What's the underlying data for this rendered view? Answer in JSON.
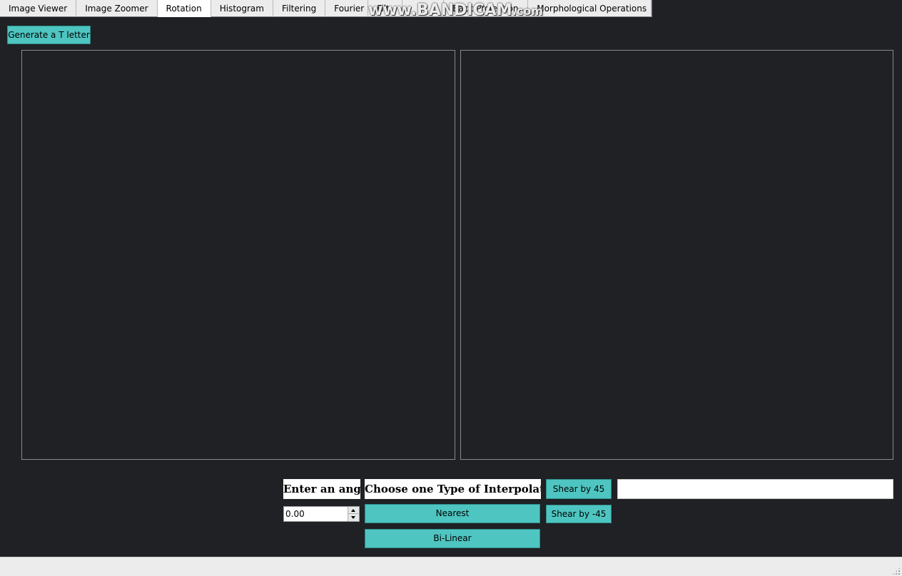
{
  "tabs": [
    {
      "label": "Image Viewer",
      "active": false
    },
    {
      "label": "Image Zoomer",
      "active": false
    },
    {
      "label": "Rotation",
      "active": true
    },
    {
      "label": "Histogram",
      "active": false
    },
    {
      "label": "Filtering",
      "active": false
    },
    {
      "label": "Fourier",
      "active": false
    },
    {
      "label": "Filt",
      "active": false
    },
    {
      "label": "",
      "active": false
    },
    {
      "label": "Back Projection",
      "active": false
    },
    {
      "label": "Morphological Operations",
      "active": false
    }
  ],
  "watermark": {
    "main": "www.BANDICAM",
    "suffix": ".com"
  },
  "rotation": {
    "generate_button": "Generate a T letter",
    "angle_label": "Enter an angle",
    "angle_value": "0.00",
    "interpolation_label": "Choose one Type of Interpolation",
    "nearest_button": "Nearest",
    "bilinear_button": "Bi-Linear",
    "shear_pos_button": "Shear by 45",
    "shear_neg_button": "Shear by -45",
    "output_value": ""
  },
  "colors": {
    "background": "#1f2125",
    "button": "#4ec5c1",
    "panel_border": "#8a8a8a"
  }
}
